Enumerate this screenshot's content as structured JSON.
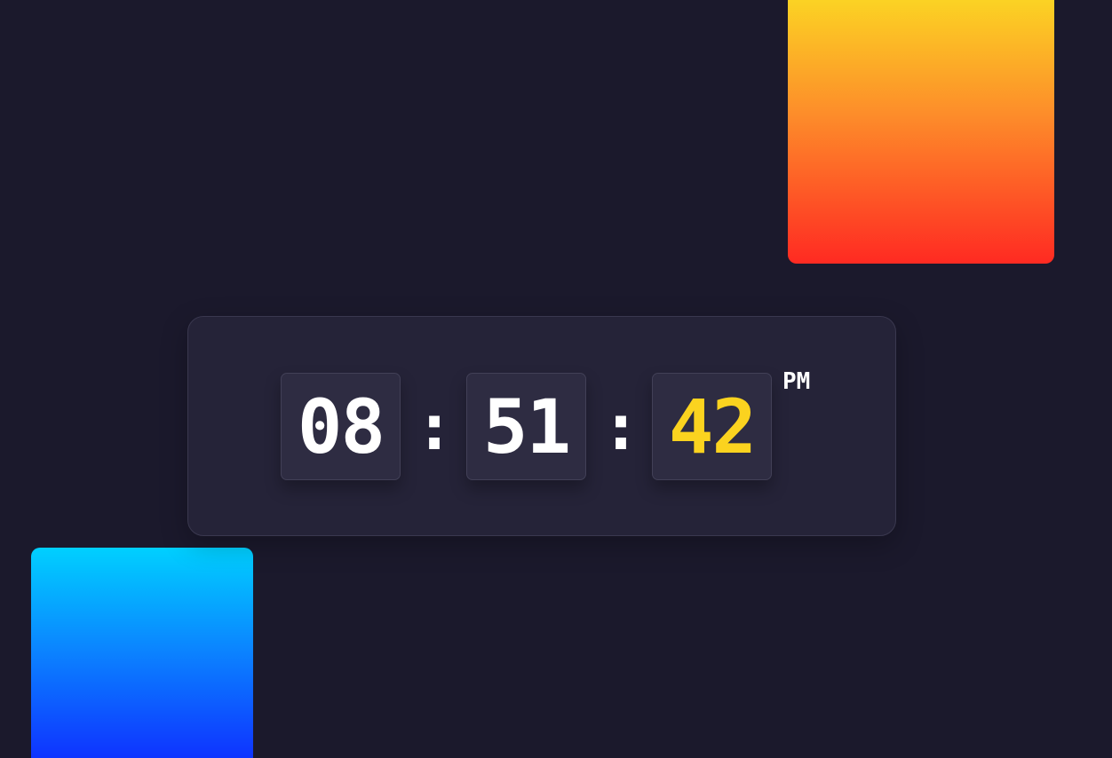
{
  "clock": {
    "hours": "08",
    "minutes": "51",
    "seconds": "42",
    "separator": ":",
    "period": "PM"
  },
  "colors": {
    "background": "#1b192c",
    "panel": "#252338",
    "digit_text": "#ffffff",
    "seconds_accent": "#fbd31f",
    "warm_gradient": [
      "#fbd823",
      "#fd8d2a",
      "#ff2a22"
    ],
    "cool_gradient": [
      "#00d0ff",
      "#0b86ff",
      "#0f2bff"
    ]
  }
}
